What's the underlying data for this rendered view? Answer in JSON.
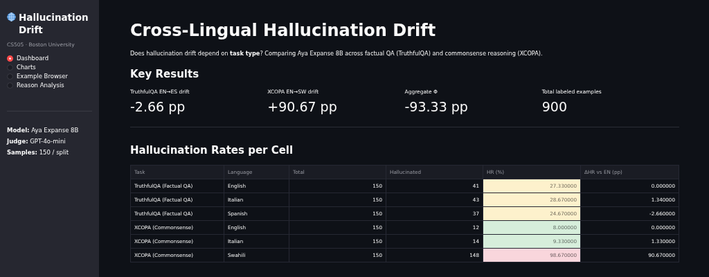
{
  "sidebar": {
    "title": "Hallucination Drift",
    "subtitle": "CS505 · Boston University",
    "nav": [
      {
        "label": "Dashboard",
        "selected": true
      },
      {
        "label": "Charts",
        "selected": false
      },
      {
        "label": "Example Browser",
        "selected": false
      },
      {
        "label": "Reason Analysis",
        "selected": false
      }
    ],
    "info": [
      {
        "key": "Model:",
        "value": "Aya Expanse 8B"
      },
      {
        "key": "Judge:",
        "value": "GPT-4o-mini"
      },
      {
        "key": "Samples:",
        "value": "150 / split"
      }
    ]
  },
  "main": {
    "title": "Cross-Lingual Hallucination Drift",
    "intro": "Does hallucination drift depend on **task type**? Comparing Aya Expanse 8B across factual QA (TruthfulQA) and commonsense reasoning (XCOPA).",
    "key_results_heading": "Key Results",
    "metrics": [
      {
        "label": "TruthfulQA EN→ES drift",
        "value": "-2.66 pp"
      },
      {
        "label": "XCOPA EN→SW drift",
        "value": "+90.67 pp"
      },
      {
        "label": "Aggregate Φ",
        "value": "-93.33 pp"
      },
      {
        "label": "Total labeled examples",
        "value": "900"
      }
    ],
    "table_heading": "Hallucination Rates per Cell",
    "table": {
      "columns": [
        "Task",
        "Language",
        "Total",
        "Hallucinated",
        "HR (%)",
        "ΔHR vs EN (pp)"
      ],
      "rows": [
        {
          "cells": [
            "TruthfulQA (Factual QA)",
            "English",
            "150",
            "41",
            "27.330000",
            "0.000000"
          ],
          "color": "#fdf1cc"
        },
        {
          "cells": [
            "TruthfulQA (Factual QA)",
            "Italian",
            "150",
            "43",
            "28.670000",
            "1.340000"
          ],
          "color": "#fdf1cc"
        },
        {
          "cells": [
            "TruthfulQA (Factual QA)",
            "Spanish",
            "150",
            "37",
            "24.670000",
            "-2.660000"
          ],
          "color": "#fdf1cc"
        },
        {
          "cells": [
            "XCOPA (Commonsense)",
            "English",
            "150",
            "12",
            "8.000000",
            "0.000000"
          ],
          "color": "#d6eedb"
        },
        {
          "cells": [
            "XCOPA (Commonsense)",
            "Italian",
            "150",
            "14",
            "9.330000",
            "1.330000"
          ],
          "color": "#d6eedb"
        },
        {
          "cells": [
            "XCOPA (Commonsense)",
            "Swahili",
            "150",
            "148",
            "98.670000",
            "90.670000"
          ],
          "color": "#f9d6dc"
        }
      ]
    }
  }
}
